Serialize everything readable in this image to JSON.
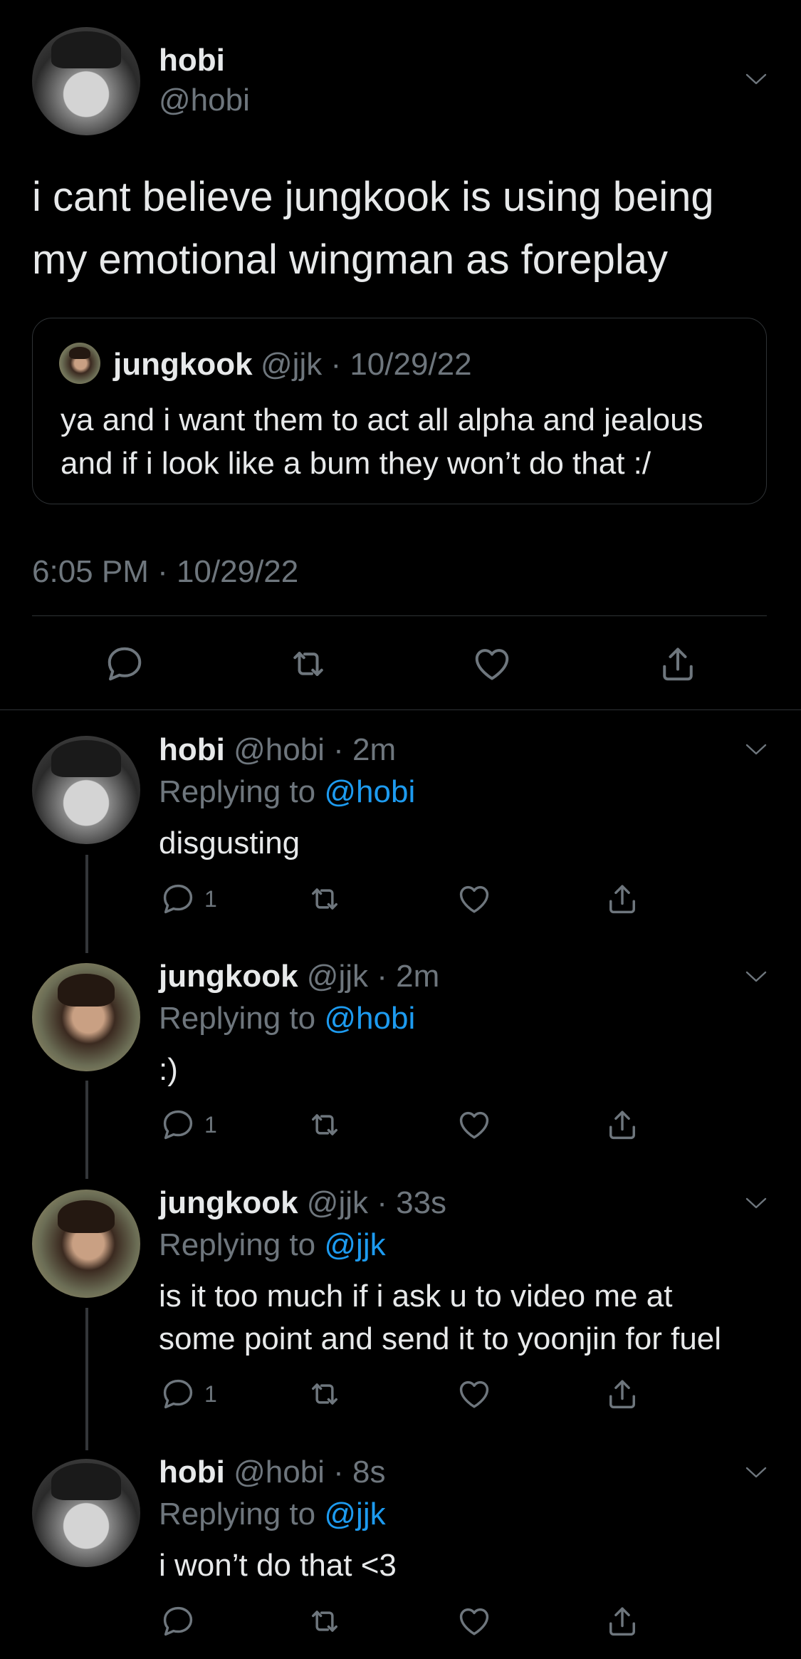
{
  "main_tweet": {
    "display_name": "hobi",
    "handle": "@hobi",
    "text_line1": "i cant believe jungkook is using being",
    "text_line2": "my emotional wingman as foreplay",
    "timestamp": "6:05 PM · 10/29/22",
    "quote": {
      "display_name": "jungkook",
      "handle_date": "@jjk · 10/29/22",
      "text_line1": "ya and i want them to act all alpha and jealous",
      "text_line2": "and if i look like a bum they won’t do that :/"
    }
  },
  "replies": [
    {
      "display_name": "hobi",
      "meta": "@hobi · 2m",
      "replying_prefix": "Replying to",
      "replying_to": "@hobi",
      "text_line1": "disgusting",
      "text_line2": "",
      "reply_count": "1"
    },
    {
      "display_name": "jungkook",
      "meta": "@jjk · 2m",
      "replying_prefix": "Replying to",
      "replying_to": "@hobi",
      "text_line1": ":)",
      "text_line2": "",
      "reply_count": "1"
    },
    {
      "display_name": "jungkook",
      "meta": "@jjk · 33s",
      "replying_prefix": "Replying to",
      "replying_to": "@jjk",
      "text_line1": "is it too much if i ask u to video me at",
      "text_line2": "some point and send it to yoonjin for fuel",
      "reply_count": "1"
    },
    {
      "display_name": "hobi",
      "meta": "@hobi · 8s",
      "replying_prefix": "Replying to",
      "replying_to": "@jjk",
      "text_line1": "i won’t do that <3",
      "text_line2": "",
      "reply_count": ""
    }
  ],
  "icons": {
    "reply": "speech-bubble-icon",
    "retweet": "retweet-arrows-icon",
    "like": "heart-icon",
    "share": "share-upload-icon",
    "more": "chevron-down-icon"
  },
  "colors": {
    "background": "#000000",
    "text": "#e7e9ea",
    "secondary": "#6e767d",
    "link": "#1d9bf0",
    "divider": "#2f3336"
  }
}
